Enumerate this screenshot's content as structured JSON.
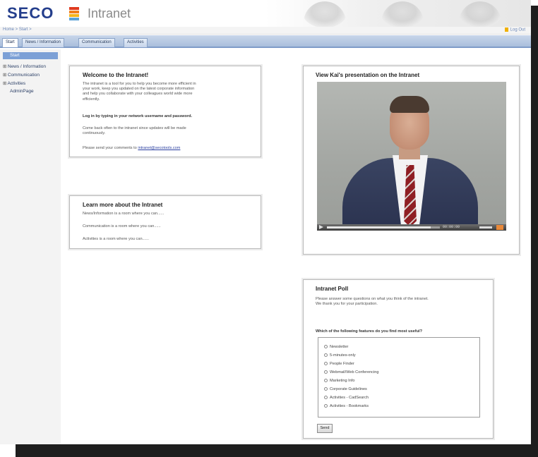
{
  "header": {
    "logo_text": "SECO",
    "app_title": "Intranet",
    "logo_colors": [
      "#e03a1e",
      "#f07e1c",
      "#f4b41c",
      "#5aa2d8"
    ]
  },
  "breadcrumb": "Home > Start >",
  "logout_label": "Log Out",
  "tabs": [
    {
      "label": "Start",
      "active": true
    },
    {
      "label": "News / Information",
      "active": false
    },
    {
      "label": "Communication",
      "active": false
    },
    {
      "label": "Activities",
      "active": false
    }
  ],
  "sidebar": {
    "active_item": "Start",
    "items": [
      {
        "label": "News / Information",
        "expandable": true
      },
      {
        "label": "Communication",
        "expandable": true
      },
      {
        "label": "Activities",
        "expandable": true
      },
      {
        "label": "AdminPage",
        "expandable": false
      }
    ]
  },
  "welcome": {
    "title": "Welcome to the Intranet!",
    "intro_lines": [
      "The intranet is a tool for you to help you become more efficient in",
      "your work, keep you updated on the latest corporate information",
      "and help you collaborate with your colleagues world wide more",
      "efficiently."
    ],
    "login_note": "Log in by typing in your network username and password.",
    "come_back_lines": [
      "Come back often to the intranet since updates will be made",
      "continuously."
    ],
    "comments_prefix": "Please send your comments to",
    "comments_email": "intranet@secotools.com"
  },
  "learn_more": {
    "title": "Learn more about the Intranet",
    "lines": [
      "News/Information is a room where you can......",
      "Communication is a room where you can......",
      "Activities is a room where you can......"
    ]
  },
  "video_panel": {
    "title": "View Kai's presentation on the Intranet",
    "time": "00:00:00",
    "progress": 0.92
  },
  "poll": {
    "title": "Intranet Poll",
    "intro_lines": [
      "Please answer some questions on what you think of the intranet.",
      "We thank you for your participation."
    ],
    "question": "Which of the following features do you find most useful?",
    "options": [
      "Newsletter",
      "5-minutes-only",
      "People Finder",
      "Webmail/Web Conferencing",
      "Marketing Info",
      "Corporate Guidelines",
      "Activities - CadSearch",
      "Activities - Bookmarks"
    ],
    "send_label": "Send"
  }
}
